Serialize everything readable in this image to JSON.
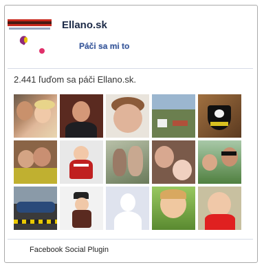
{
  "page": {
    "name": "Ellano.sk",
    "like_label": "Páči sa mi to",
    "fan_count_text": "2.441 ľuďom sa páči Ellano.sk."
  },
  "fans": [
    {
      "name": "fan-1"
    },
    {
      "name": "fan-2"
    },
    {
      "name": "fan-3"
    },
    {
      "name": "fan-4"
    },
    {
      "name": "fan-5"
    },
    {
      "name": "fan-6"
    },
    {
      "name": "fan-7"
    },
    {
      "name": "fan-8"
    },
    {
      "name": "fan-9"
    },
    {
      "name": "fan-10"
    },
    {
      "name": "fan-11"
    },
    {
      "name": "fan-12"
    },
    {
      "name": "fan-13"
    },
    {
      "name": "fan-14"
    },
    {
      "name": "fan-15"
    }
  ],
  "footer": {
    "text": "Facebook Social Plugin"
  }
}
